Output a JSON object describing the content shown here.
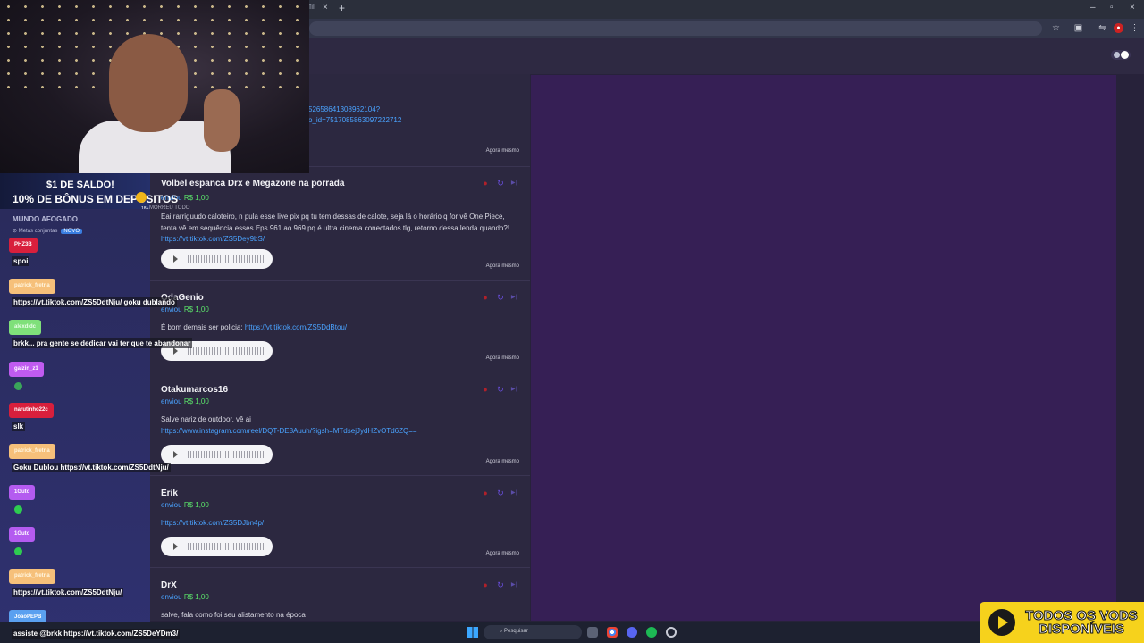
{
  "browser": {
    "tab_partial": "fil",
    "tab_close": "×",
    "new_tab": "+",
    "win_min": "–",
    "win_max": "▫",
    "win_close": "×"
  },
  "feed": {
    "top_link_1": "52658641308962104?",
    "top_link_2": "o_id=7517085863097222712",
    "top_time": "Agora mesmo",
    "cards": [
      {
        "name": "Volbel espanca Drx e Megazone na porrada",
        "sent": "enviou",
        "amount": "R$ 1,00",
        "msg": "Eai rarriguudo caloteiro, n pula esse live pix pq tu tem dessas de calote, seja lá o horário q for vê One Piece, tenta vê em sequência esses Eps 961 ao 969 pq é ultra cinema conectados tlg, retorno dessa lenda quando?!",
        "link": "https://vt.tiktok.com/ZS5Dey9bS/",
        "time": "Agora mesmo"
      },
      {
        "name": "OdaGenio",
        "sent": "enviou",
        "amount": "R$ 1,00",
        "msg": "É bom demais ser policia:",
        "link": "https://vt.tiktok.com/ZS5DdBtou/",
        "time": "Agora mesmo"
      },
      {
        "name": "Otakumarcos16",
        "sent": "enviou",
        "amount": "R$ 1,00",
        "msg": "Salve nariz de outdoor, vê ai",
        "link": "https://www.instagram.com/reel/DQT-DE8Auuh/?igsh=MTdsejJydHZvOTd6ZQ==",
        "time": "Agora mesmo"
      },
      {
        "name": "Erik",
        "sent": "enviou",
        "amount": "R$ 1,00",
        "msg": "",
        "link": "https://vt.tiktok.com/ZS5DJbn4p/",
        "time": "Agora mesmo"
      },
      {
        "name": "DrX",
        "sent": "enviou",
        "amount": "R$ 1,00",
        "msg": "salve, fala como foi seu alistamento na época",
        "link": "",
        "time": ""
      }
    ]
  },
  "promo": {
    "line1": "$1 DE SALDO!",
    "line2": "10% DE BÔNUS EM DEPÓSITOS",
    "badge": "18+",
    "strip": "MORREU TODO"
  },
  "chat": {
    "title": "MUNDO AFOGADO",
    "subtitle": "Metas conjuntas",
    "subtitle_badge": "NOVO",
    "messages": [
      {
        "user": "PHZ3B",
        "text": "spoi",
        "user_color": "#d81f3c"
      },
      {
        "user": "patrick_fretna",
        "text": "https://vt.tiktok.com/ZS5DdtNju/ goku dublando",
        "user_color": "#f6c07a"
      },
      {
        "user": "alexdidc",
        "text": "brkk... pra gente se dedicar vai ter que te abandonar",
        "user_color": "#7fe07a"
      },
      {
        "user": "gaizin_z1",
        "text": "",
        "user_color": "#c05bf0"
      },
      {
        "user": "narutinho22c",
        "text": "slk",
        "user_color": "#d81f3c"
      },
      {
        "user": "patrick_fretna",
        "text": "Goku Dublou https://vt.tiktok.com/ZS5DdtNju/",
        "user_color": "#f6c07a"
      },
      {
        "user": "1Guto",
        "text": "",
        "user_color": "#b45bf0"
      },
      {
        "user": "1Guto",
        "text": "",
        "user_color": "#b45bf0"
      },
      {
        "user": "patrick_fretna",
        "text": "https://vt.tiktok.com/ZS5DdtNju/",
        "user_color": "#f6c07a"
      },
      {
        "user": "JoaoPEPB",
        "text": "assiste @brkk https://vt.tiktok.com/ZS5DeYDm3/",
        "user_color": "#5aa0f0"
      }
    ]
  },
  "taskbar": {
    "search_label": "Pesquisar"
  },
  "vods_ad": {
    "line1": "TODOS OS VODS",
    "line2": "DISPONÍVEIS"
  },
  "colors": {
    "accent_link": "#4aa3ff",
    "amount_green": "#5be36a",
    "right_panel": "#361f55",
    "vods_yellow": "#f6d21c"
  }
}
